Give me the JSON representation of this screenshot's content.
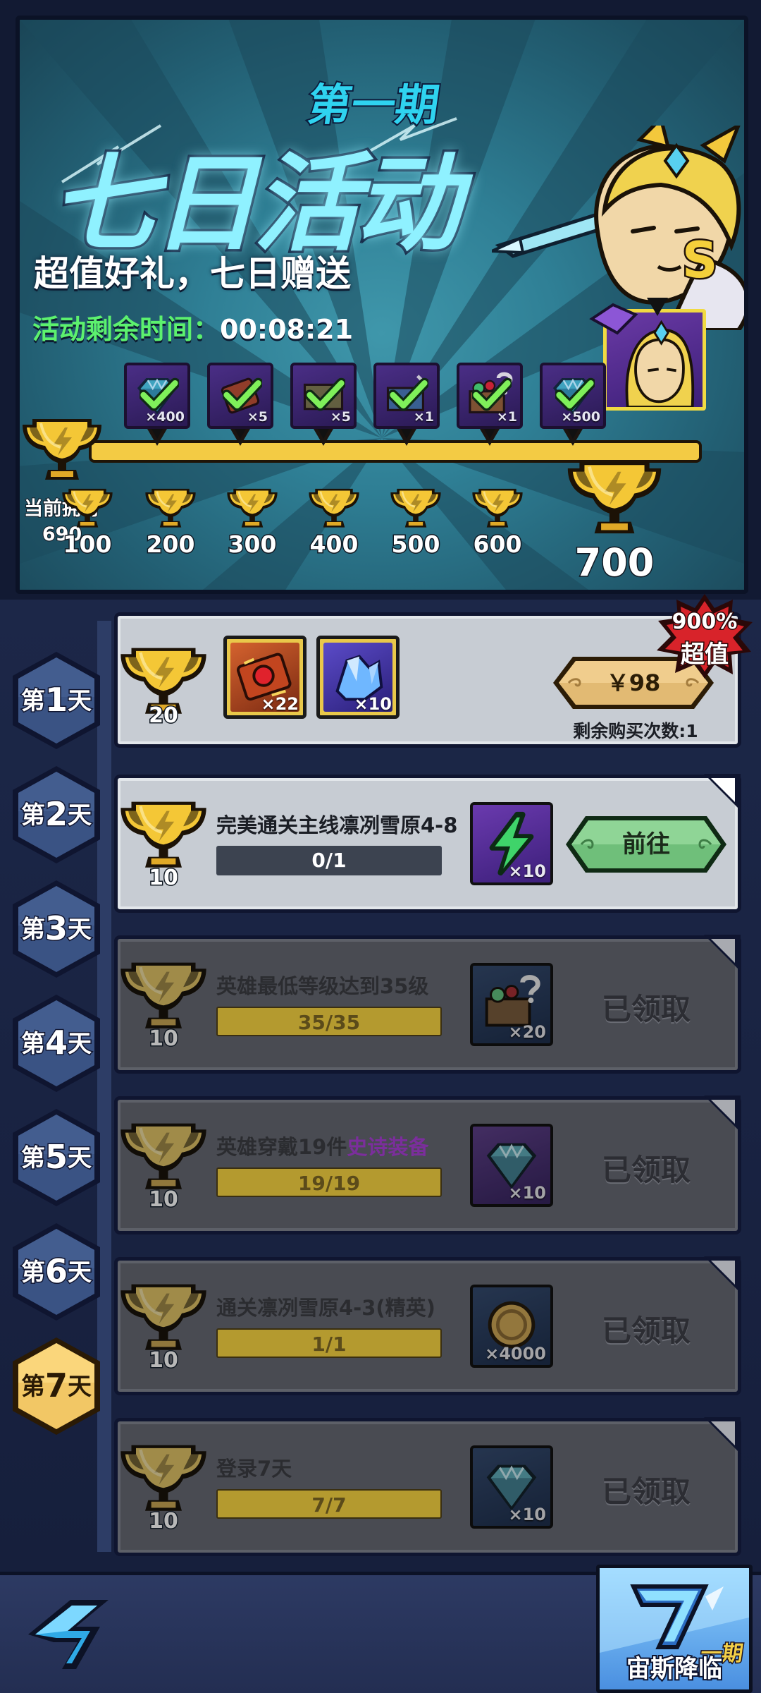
{
  "banner": {
    "period_label": "第一期",
    "title": "七日活动",
    "slogan": "超值好礼，七日赠送",
    "timer_label": "活动剩余时间：",
    "timer_value": "00:08:21",
    "hero_rank": "S",
    "owned_label": "当前拥有",
    "owned_value": "690",
    "track_rewards": [
      {
        "icon": "diamond-icon",
        "qty": "×400"
      },
      {
        "icon": "scroll-icon",
        "qty": "×5"
      },
      {
        "icon": "equipment-chest-icon",
        "qty": "×5"
      },
      {
        "icon": "hero-chest-icon",
        "qty": "×1"
      },
      {
        "icon": "mystery-chest-icon",
        "qty": "×1"
      },
      {
        "icon": "diamond-icon",
        "qty": "×500"
      }
    ],
    "milestones": [
      "100",
      "200",
      "300",
      "400",
      "500",
      "600",
      "700"
    ]
  },
  "days": [
    {
      "prefix": "第",
      "num": "1",
      "suffix": "天"
    },
    {
      "prefix": "第",
      "num": "2",
      "suffix": "天"
    },
    {
      "prefix": "第",
      "num": "3",
      "suffix": "天"
    },
    {
      "prefix": "第",
      "num": "4",
      "suffix": "天"
    },
    {
      "prefix": "第",
      "num": "5",
      "suffix": "天"
    },
    {
      "prefix": "第",
      "num": "6",
      "suffix": "天"
    },
    {
      "prefix": "第",
      "num": "7",
      "suffix": "天"
    }
  ],
  "active_day": "7",
  "gift_pack": {
    "trophy_value": "20",
    "items": [
      {
        "icon": "red-gem-scroll-icon",
        "qty": "×22"
      },
      {
        "icon": "crystal-cluster-icon",
        "qty": "×10"
      }
    ],
    "price": "￥98",
    "remain": "剩余购买次数:1",
    "badge_pct": "900%",
    "badge_text": "超值"
  },
  "tasks": [
    {
      "trophy_value": "10",
      "title": "完美通关主线凛冽雪原4-8",
      "progress": "0/1",
      "reward_icon": "energy-bolt-icon",
      "reward_qty": "×10",
      "action": "前往",
      "state": "active"
    },
    {
      "trophy_value": "10",
      "title": "英雄最低等级达到35级",
      "progress": "35/35",
      "reward_icon": "mystery-chest-icon",
      "reward_qty": "×20",
      "action": "已领取",
      "state": "claimed"
    },
    {
      "trophy_value": "10",
      "title_main": "英雄穿戴19件",
      "title_epic": "史诗装备",
      "progress": "19/19",
      "reward_icon": "diamond-icon",
      "reward_qty": "×10",
      "action": "已领取",
      "state": "claimed"
    },
    {
      "trophy_value": "10",
      "title": "通关凛冽雪原4-3(精英)",
      "progress": "1/1",
      "reward_icon": "gold-coin-icon",
      "reward_qty": "×4000",
      "action": "已领取",
      "state": "claimed"
    },
    {
      "trophy_value": "10",
      "title": "登录7天",
      "progress": "7/7",
      "reward_icon": "diamond-icon",
      "reward_qty": "×10",
      "action": "已领取",
      "state": "claimed"
    }
  ],
  "bottom": {
    "promo_period": "一期",
    "promo_name": "宙斯降临"
  },
  "colors": {
    "accent_green": "#5cf16e",
    "trophy_gold": "#f3cb44",
    "active_day": "#f2c765",
    "epic_purple": "#7b2e9c"
  }
}
